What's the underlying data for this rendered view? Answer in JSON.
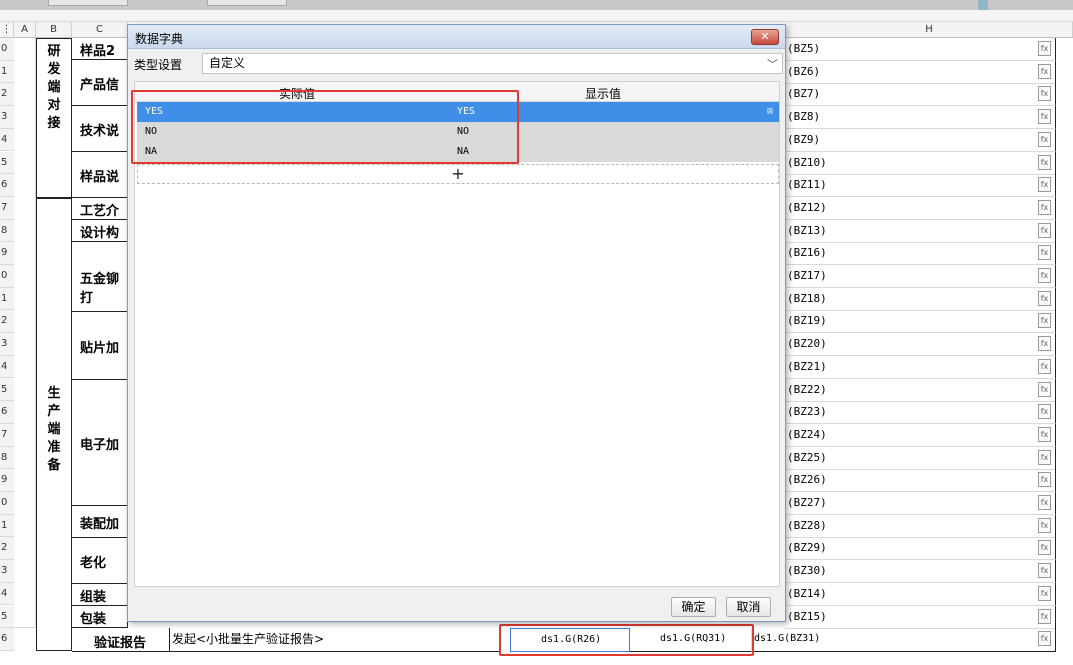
{
  "dialog": {
    "title": "数据字典",
    "close_label": "✕",
    "type_label": "类型设置",
    "type_value": "自定义",
    "col_actual": "实际值",
    "col_display": "显示值",
    "rows": [
      {
        "actual": "YES",
        "display": "YES"
      },
      {
        "actual": "NO",
        "display": "NO"
      },
      {
        "actual": "NA",
        "display": "NA"
      }
    ],
    "add_label": "+",
    "ok_label": "确定",
    "cancel_label": "取消"
  },
  "sheet": {
    "columns": [
      "A",
      "B",
      "C",
      "H"
    ],
    "row_numbers": [
      "0",
      "1",
      "2",
      "3",
      "4",
      "5",
      "6",
      "7",
      "8",
      "9",
      "0",
      "1",
      "2",
      "3",
      "4",
      "5",
      "6",
      "7",
      "8",
      "9",
      "0",
      "1",
      "2",
      "3",
      "4",
      "5",
      "6"
    ],
    "categories": {
      "rd": "研发端对接",
      "prod": "生产端准备"
    },
    "c_labels": [
      "样品2",
      "产品信",
      "技术说",
      "样品说",
      "工艺介",
      "设计构",
      "五金铆打",
      "贴片加",
      "电子加",
      "装配加",
      "老化",
      "组装",
      "包装",
      "验证报告"
    ],
    "h_values": [
      "(BZ5)",
      "(BZ6)",
      "(BZ7)",
      "(BZ8)",
      "(BZ9)",
      "(BZ10)",
      "(BZ11)",
      "(BZ12)",
      "(BZ13)",
      "(BZ16)",
      "(BZ17)",
      "(BZ18)",
      "(BZ19)",
      "(BZ20)",
      "(BZ21)",
      "(BZ22)",
      "(BZ23)",
      "(BZ24)",
      "(BZ25)",
      "(BZ26)",
      "(BZ27)",
      "(BZ28)",
      "(BZ29)",
      "(BZ30)",
      "(BZ14)",
      "(BZ15)"
    ],
    "fx_label": "fx",
    "bottom": {
      "desc": "发起<小批量生产验证报告>",
      "e_value": "ds1.G(R26)",
      "f_value": "ds1.G(RQ31)",
      "h_value": "ds1.G(BZ31)"
    }
  },
  "colors": {
    "accent": "#3f8ee8",
    "highlight_red": "#e03a35"
  }
}
